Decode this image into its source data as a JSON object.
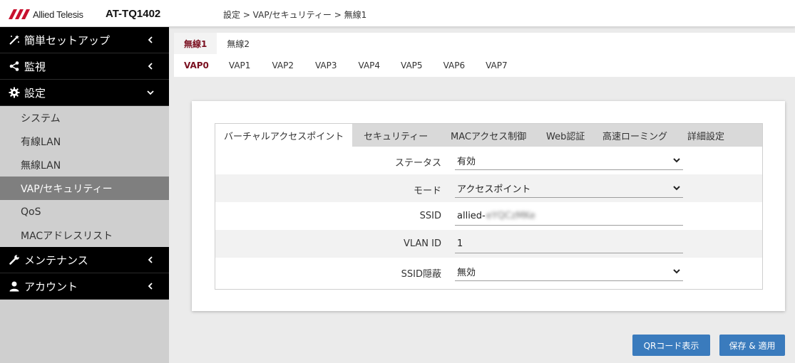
{
  "header": {
    "brand": "Allied Telesis",
    "model": "AT-TQ1402",
    "breadcrumb": "設定 > VAP/セキュリティー > 無線1"
  },
  "sidebar": {
    "sections": [
      {
        "label": "簡単セットアップ",
        "icon": "magic-wand-icon"
      },
      {
        "label": "監視",
        "icon": "share-icon"
      },
      {
        "label": "設定",
        "icon": "gear-icon",
        "expanded": true
      },
      {
        "label": "メンテナンス",
        "icon": "wrench-icon"
      },
      {
        "label": "アカウント",
        "icon": "user-icon"
      }
    ],
    "sub_items": [
      "システム",
      "有線LAN",
      "無線LAN",
      "VAP/セキュリティー",
      "QoS",
      "MACアドレスリスト"
    ],
    "active_sub": "VAP/セキュリティー"
  },
  "radio_tabs": [
    "無線1",
    "無線2"
  ],
  "radio_active": "無線1",
  "vap_tabs": [
    "VAP0",
    "VAP1",
    "VAP2",
    "VAP3",
    "VAP4",
    "VAP5",
    "VAP6",
    "VAP7"
  ],
  "vap_active": "VAP0",
  "inner_tabs": [
    "バーチャルアクセスポイント",
    "セキュリティー",
    "MACアクセス制御",
    "Web認証",
    "高速ローミング",
    "詳細設定"
  ],
  "inner_active": "バーチャルアクセスポイント",
  "form": {
    "status": {
      "label": "ステータス",
      "value": "有効"
    },
    "mode": {
      "label": "モード",
      "value": "アクセスポイント"
    },
    "ssid": {
      "label": "SSID",
      "value_prefix": "allied-",
      "value_masked": "eYQCzMKe"
    },
    "vlan": {
      "label": "VLAN ID",
      "value": "1"
    },
    "ssid_hide": {
      "label": "SSID隠蔽",
      "value": "無効"
    }
  },
  "buttons": {
    "qr": "QRコード表示",
    "save": "保存 & 適用"
  },
  "colors": {
    "accent_active_tab": "#7a1020",
    "button_blue": "#3a7bbd",
    "sidebar_dark": "#000000",
    "sidebar_active": "#7f7f7f",
    "logo_red": "#c8102e"
  }
}
